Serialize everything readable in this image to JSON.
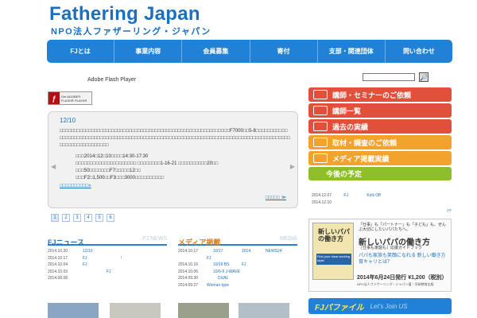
{
  "header": {
    "title": "Fathering Japan",
    "subtitle": "NPO法人ファザーリング・ジャパン"
  },
  "nav": {
    "items": [
      "FJとは",
      "事業内容",
      "会員募集",
      "寄付",
      "支部・関連団体",
      "問い合わせ"
    ]
  },
  "flash": {
    "label": "Adobe Flash Player",
    "badge_line1": "Get ADOBE®",
    "badge_line2": "FLASH® PLAYER"
  },
  "search": {
    "button_label": "🔎"
  },
  "slider": {
    "date": "12/10",
    "body": "□□□□□□□□□□□□□□□□□□□□□□□□□□□□□□□□□□□□□□□□□□□□□□□□□□□□□□□□□□□F7000□□5-8□□□□□□□□□□□□□□□□□□□□□□□□□□□□□□□□□□□□□□□□□□□□□□□□□□□□□□□□□□□□□□□□□□□□□□□□□□□□□□□□□□□□□□□□□□□□□□□□□□□□□□□□□□□□",
    "details": [
      "□□□2014□12□10□□□□14:30-17:30",
      "□□□□□□□□□□□□□□□□□□□□□ □□□□□□□□1-16-21 □□□□□□□□□□20□□",
      "□□□50□□□□□□□F7□□□□□12□□",
      "□□□F2□1,500□□F3□□□3000□□□□□□□□□□"
    ],
    "category_link": "□□□□□□□□□□»",
    "more_link": "□□□□□ ≫",
    "prev": "◀",
    "next": "▶"
  },
  "pager": [
    "1",
    "2",
    "3",
    "4",
    "5",
    "6"
  ],
  "sidebar": {
    "items": [
      {
        "label": "講師・セミナーのご依頼"
      },
      {
        "label": "講師一覧"
      },
      {
        "label": "過去の実績"
      },
      {
        "label": "取材・調査のご依頼"
      },
      {
        "label": "メディア掲載実績"
      },
      {
        "label": "今後の予定"
      }
    ],
    "schedule": [
      {
        "date": "2014.12.07",
        "text": "FJ",
        "extra": "Kick Off"
      },
      {
        "date": "2014.12.10",
        "text": "",
        "extra": ""
      }
    ],
    "schedule_more": ">>"
  },
  "fj_news": {
    "title": "FJニュース",
    "en": "FJ NEWS",
    "rows": [
      {
        "date": "2014.10.20",
        "t": "12/10",
        "t2": ""
      },
      {
        "date": "2014.10.17",
        "t": "FJ",
        "t2": "!"
      },
      {
        "date": "2014.10.04",
        "t": "FJ",
        "t2": ""
      },
      {
        "date": "2014.10.03",
        "t": "",
        "t2": "FJ"
      },
      {
        "date": "2014.08.08",
        "t": "",
        "t2": ""
      }
    ]
  },
  "media": {
    "title": "メディア掲載",
    "en": "MEDIA",
    "rows": [
      {
        "date": "2014.10.17",
        "t": "10/17",
        "t2": "2014",
        "t3": "NEWS24"
      },
      {
        "date": "",
        "t": "FJ",
        "t2": "",
        "t3": ""
      },
      {
        "date": "2014.10.16",
        "t": "10/16 BS",
        "t2": "FJ",
        "t3": ""
      },
      {
        "date": "2014.10.06",
        "t": "10/6-9 J-WAVE",
        "t2": "",
        "t3": ""
      },
      {
        "date": "2014.09.30",
        "t": "",
        "t2": "DUAL",
        "t3": ""
      },
      {
        "date": "2014.09.27",
        "t": "Woman type",
        "t2": "",
        "t3": ""
      }
    ]
  },
  "book": {
    "tagline": "「仕事」も「パートナー」も「子ども」も、ぜんぶ大切にしたいパパたちへ。",
    "cover_title": "新しいパパの働き方",
    "cover_en": "Find your ideal working style!",
    "title": "新しいパパの働き方",
    "sub": "［仕事も家庭も］応援ガイドブック",
    "note": "パパも家族も笑顔になれる 新しい働き方 育キャリとは？",
    "date": "2014年6月24日発行 ¥1,200（税別）",
    "publisher": "NPO法人ファザーリング・ジャパン著｜学研教育出版"
  },
  "fj_file": {
    "title": "FJパファイル",
    "sub": "Let's Join US"
  },
  "colors": {
    "brand_blue": "#2181d6",
    "sidebar_red": "#e0503a",
    "sidebar_orange": "#f1a32d",
    "sidebar_green": "#8fbe2c"
  }
}
